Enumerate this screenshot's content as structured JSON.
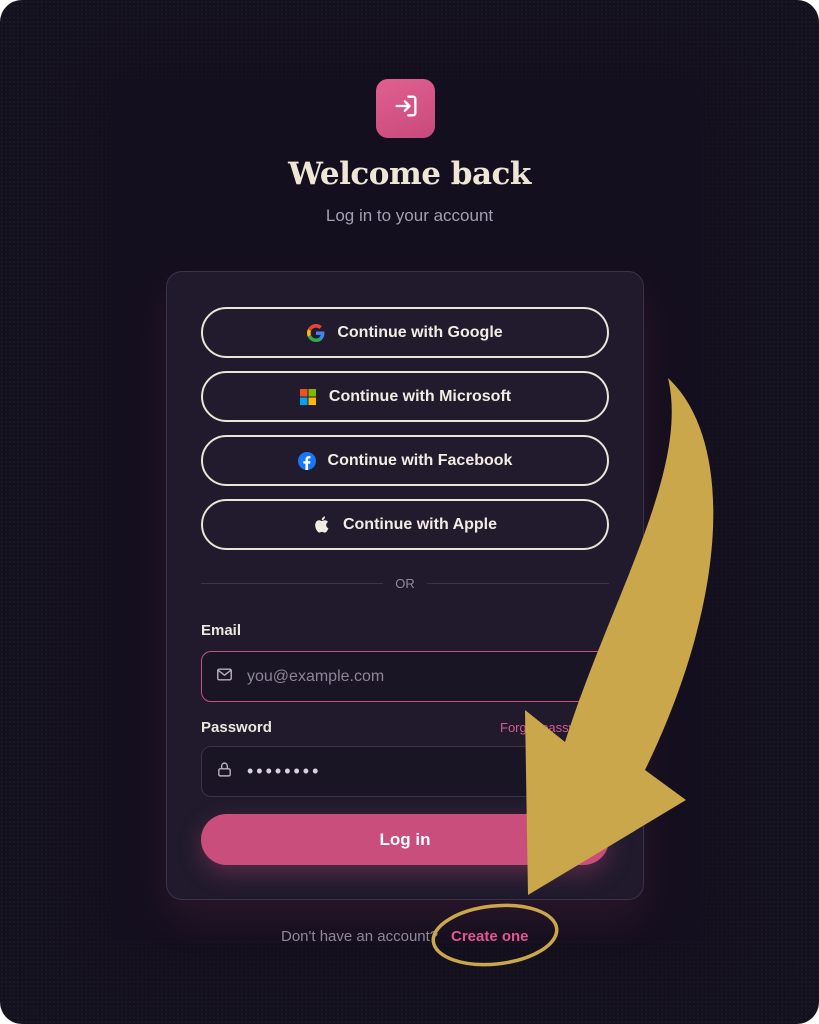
{
  "header": {
    "logo_icon": "login-arrow-icon",
    "title": "Welcome back",
    "subtitle": "Log in to your account"
  },
  "oauth": [
    {
      "label": "Continue with Google",
      "icon": "google-icon"
    },
    {
      "label": "Continue with Microsoft",
      "icon": "microsoft-icon"
    },
    {
      "label": "Continue with Facebook",
      "icon": "facebook-icon"
    },
    {
      "label": "Continue with Apple",
      "icon": "apple-icon"
    }
  ],
  "divider_text": "OR",
  "form": {
    "email_label": "Email",
    "email_placeholder": "you@example.com",
    "email_value": "",
    "password_label": "Password",
    "forgot_label": "Forgot password?",
    "password_value": "••••••••",
    "submit_label": "Log in"
  },
  "footer": {
    "text": "Don't have an account?",
    "link": "Create one"
  },
  "colors": {
    "background": "#15121f",
    "card": "#201a2c",
    "accent": "#c94e7c",
    "annotation": "#c9a74a"
  }
}
